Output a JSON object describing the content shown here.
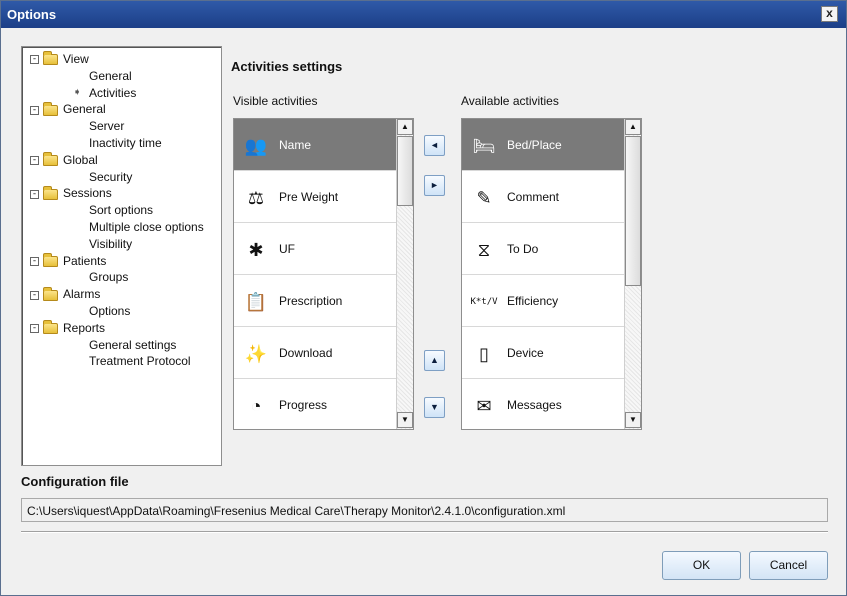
{
  "window": {
    "title": "Options",
    "close_label": "x"
  },
  "tree": [
    {
      "label": "View",
      "toggle": "-",
      "children": [
        "General",
        "Activities"
      ],
      "current_child": "Activities"
    },
    {
      "label": "General",
      "toggle": "-",
      "children": [
        "Server",
        "Inactivity time"
      ]
    },
    {
      "label": "Global",
      "toggle": "-",
      "children": [
        "Security"
      ]
    },
    {
      "label": "Sessions",
      "toggle": "-",
      "children": [
        "Sort options",
        "Multiple close options",
        "Visibility"
      ]
    },
    {
      "label": "Patients",
      "toggle": "-",
      "children": [
        "Groups"
      ]
    },
    {
      "label": "Alarms",
      "toggle": "-",
      "children": [
        "Options"
      ]
    },
    {
      "label": "Reports",
      "toggle": "-",
      "children": [
        "General settings",
        "Treatment Protocol"
      ]
    }
  ],
  "activities": {
    "title": "Activities settings",
    "visible_label": "Visible activities",
    "available_label": "Available activities",
    "visible": [
      {
        "label": "Name",
        "icon": "people-icon",
        "glyph": "👥",
        "selected": true
      },
      {
        "label": "Pre Weight",
        "icon": "weight-icon",
        "glyph": "⚖"
      },
      {
        "label": "UF",
        "icon": "uf-icon",
        "glyph": "✱"
      },
      {
        "label": "Prescription",
        "icon": "clipboard-icon",
        "glyph": "📋"
      },
      {
        "label": "Download",
        "icon": "download-wand-icon",
        "glyph": "✨"
      },
      {
        "label": "Progress",
        "icon": "progress-icon",
        "glyph": "◔"
      }
    ],
    "available": [
      {
        "label": "Bed/Place",
        "icon": "bed-icon",
        "glyph": "🛏",
        "selected": true
      },
      {
        "label": "Comment",
        "icon": "comment-icon",
        "glyph": "✎"
      },
      {
        "label": "To Do",
        "icon": "hourglass-icon",
        "glyph": "⧖"
      },
      {
        "label": "Efficiency",
        "icon": "formula-icon",
        "glyph": "K*t/V"
      },
      {
        "label": "Device",
        "icon": "device-icon",
        "glyph": "▯"
      },
      {
        "label": "Messages",
        "icon": "envelope-icon",
        "glyph": "✉"
      }
    ],
    "move_buttons": {
      "to_visible": "◄",
      "to_available": "►",
      "move_up": "▲",
      "move_down": "▼"
    },
    "scroll_up_glyph": "▲",
    "scroll_down_glyph": "▼"
  },
  "config": {
    "title": "Configuration file",
    "path": "C:\\Users\\iquest\\AppData\\Roaming\\Fresenius Medical Care\\Therapy Monitor\\2.4.1.0\\configuration.xml"
  },
  "buttons": {
    "ok": "OK",
    "cancel": "Cancel"
  }
}
